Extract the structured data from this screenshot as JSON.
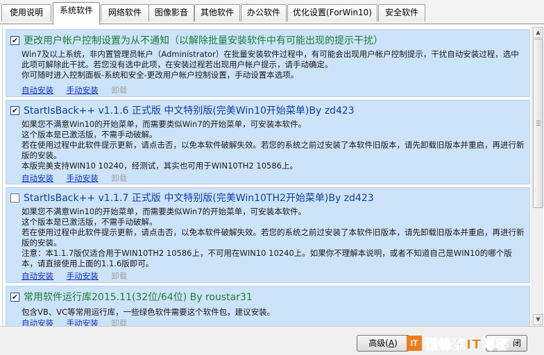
{
  "tabs": [
    {
      "label": "使用说明",
      "active": false
    },
    {
      "label": "系统软件",
      "active": true
    },
    {
      "label": "网络软件",
      "active": false
    },
    {
      "label": "图像影音",
      "active": false
    },
    {
      "label": "其他软件",
      "active": false
    },
    {
      "label": "办公软件",
      "active": false
    },
    {
      "label": "优化设置(ForWin10)",
      "active": false
    },
    {
      "label": "安全软件",
      "active": false
    }
  ],
  "items": [
    {
      "checked": true,
      "title": "更改用户帐户控制设置为从不通知（以解除批量安装软件中有可能出现的提示干扰）",
      "desc": [
        "Win7及以上系统，非内置管理员帐户（Administrator）在批量安装软件过程中，有可能会出现用户帐户控制提示，干扰自动安装过程，选中此项可解除此干扰。若您没有选中此项，在安装过程若出现用户帐户提示，请手动确定。",
        "你可随时进入控制面板-系统和安全-更改用户帐户控制设置，手动设置本选项。"
      ]
    },
    {
      "checked": true,
      "title": "StartIsBack++ v1.1.6 正式版 中文特别版(完美Win10开始菜单)By zd423",
      "desc": [
        "如果您不满意Win10的开始菜单，而需要类似Win7的开始菜单，可安装本软件。",
        "这个版本是已激活版，不需手动破解。",
        "若在使用过程中此软件提示更新，请点击否，以免本软件破解失效。若您的系统之前过安装了本软件旧版本，请先卸载旧版本并重启，再进行新版的安装。",
        "本版完美支持WIN10 10240，经测试，其实也可用于WIN10TH2 10586上。"
      ]
    },
    {
      "checked": false,
      "title": "StartIsBack++ v1.1.7 正式版 中文特别版(完美Win10TH2开始菜单)By zd423",
      "desc": [
        "如果您不满意Win10的开始菜单，而需要类似Win7的开始菜单，可安装本软件。",
        "这个版本是已激活版，不需手动破解。",
        "若在使用过程中此软件提示更新，请点击否，以免本软件破解失效。若您的系统之前过安装了本软件旧版本，请先卸载旧版本并重启，再进行新版的安装。",
        "注意：本1.1.7版仅适合用于WIN10TH2 10586上，不可用在WIN10 10240上。如果你不理解本说明，或者不知道自己是WIN10的哪个版本，请直接使用上面的1.1.6版即可。"
      ]
    },
    {
      "checked": true,
      "title": "常用软件运行库2015.11(32位/64位) By roustar31",
      "desc": [
        "包含VB、VC等常用运行库，一些绿色软件需要这个软件包，建议安装。"
      ]
    }
  ],
  "links": {
    "auto": "自动安装",
    "manual": "手动安装",
    "uninstall": "卸载"
  },
  "buttons": {
    "advanced_prefix": "高级(",
    "advanced_key": "A",
    "advanced_suffix": ")",
    "close_tail": "闭"
  },
  "watermark": {
    "logo": "IT",
    "text_a": "懒蜂东",
    "text_it": "IT",
    "text_b": "博客"
  },
  "colors": {
    "item_bg": "#cde3f9",
    "title_blue": "#0f3ea8",
    "title_green": "#1b7f38",
    "link": "#1032c4",
    "link_disabled": "#a3a3a3",
    "brand_orange": "#f07d1b"
  }
}
